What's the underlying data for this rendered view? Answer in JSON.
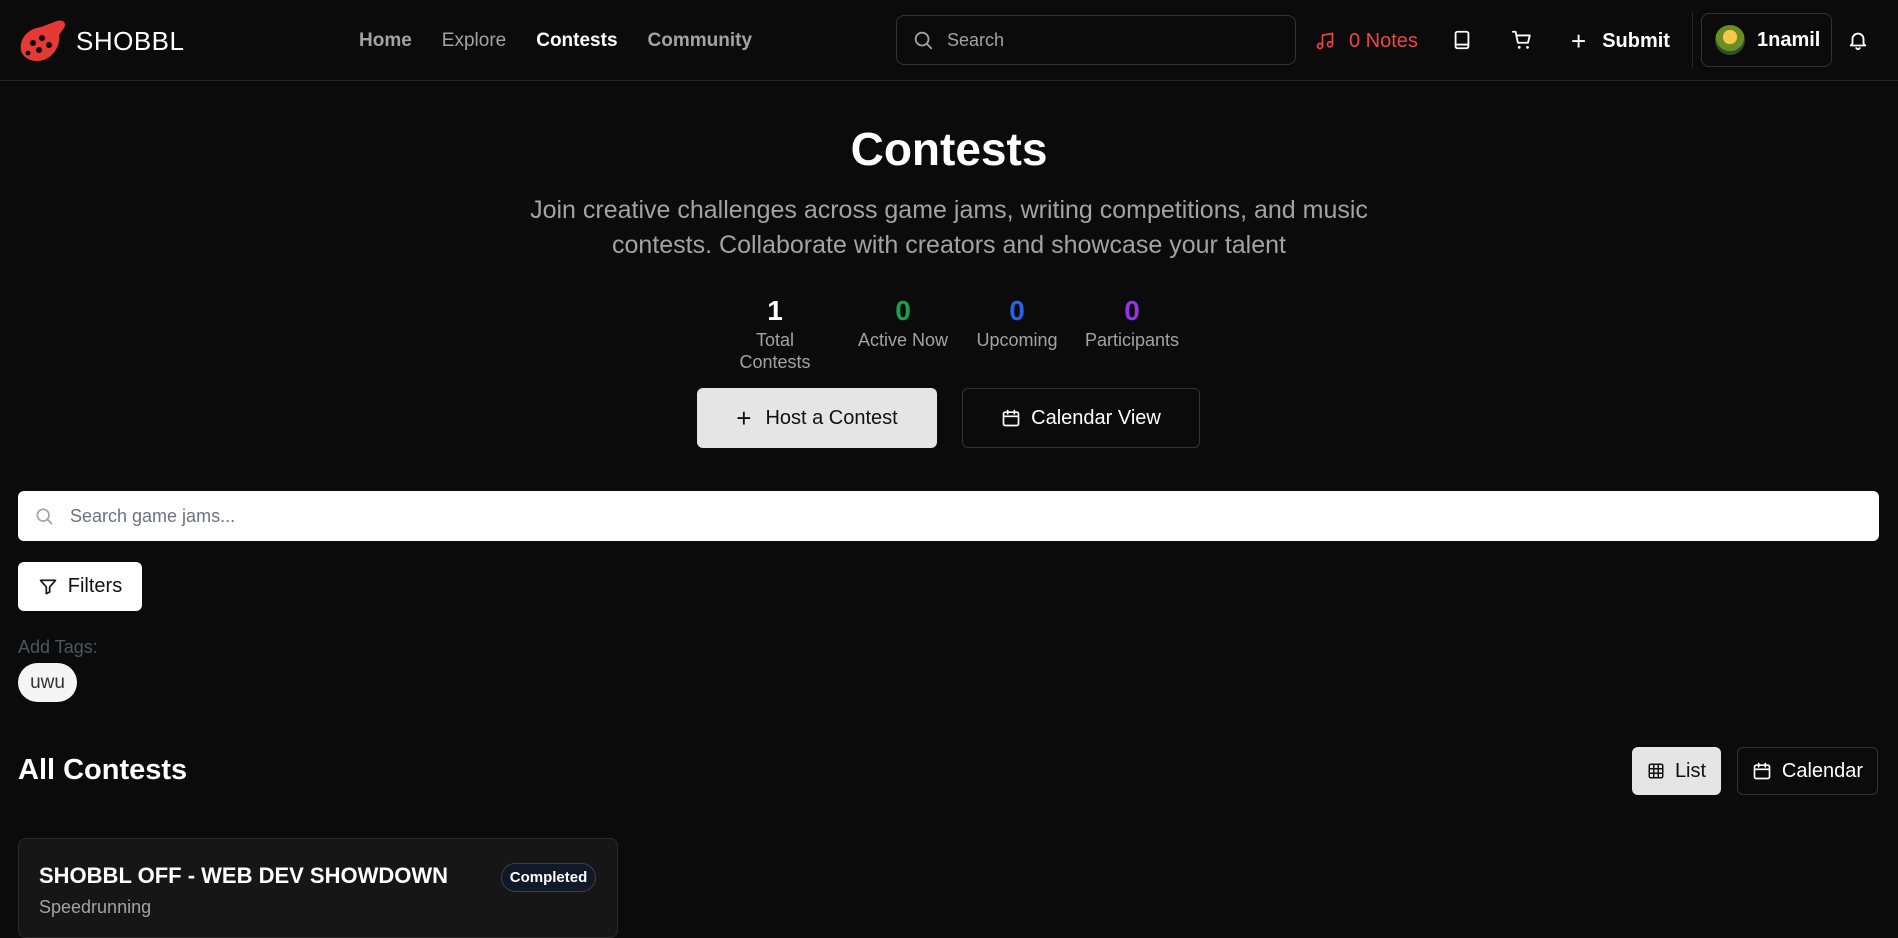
{
  "brand": {
    "name": "SHOBBL",
    "logo_icon": "ocarina-logo-icon",
    "accent": "#e53935"
  },
  "nav": {
    "items": [
      {
        "label": "Home",
        "active": false
      },
      {
        "label": "Explore",
        "active": false
      },
      {
        "label": "Contests",
        "active": true
      },
      {
        "label": "Community",
        "active": false
      }
    ]
  },
  "search": {
    "placeholder": "Search",
    "value": ""
  },
  "notes": {
    "label": "0 Notes",
    "color": "#ef4444",
    "icon": "music-note-icon"
  },
  "toolbar_icons": [
    "book-icon",
    "cart-icon",
    "bell-icon"
  ],
  "submit": {
    "label": "Submit"
  },
  "user": {
    "name": "1namil"
  },
  "hero": {
    "title": "Contests",
    "subtitle": "Join creative challenges across game jams, writing competitions, and music contests. Collaborate with creators and showcase your talent"
  },
  "stats": [
    {
      "value": "1",
      "label": "Total Contests",
      "color": "#ffffff"
    },
    {
      "value": "0",
      "label": "Active Now",
      "color": "#16a34a"
    },
    {
      "value": "0",
      "label": "Upcoming",
      "color": "#2563eb"
    },
    {
      "value": "0",
      "label": "Participants",
      "color": "#9333ea"
    }
  ],
  "actions": {
    "host": "Host a Contest",
    "calendar": "Calendar View"
  },
  "jam_search": {
    "placeholder": "Search game jams...",
    "value": ""
  },
  "filters": {
    "label": "Filters"
  },
  "tags": {
    "heading": "Add Tags:",
    "items": [
      "uwu"
    ]
  },
  "contests": {
    "heading": "All Contests",
    "view": {
      "list": "List",
      "calendar": "Calendar",
      "selected": "List"
    },
    "cards": [
      {
        "title": "SHOBBL OFF - WEB DEV SHOWDOWN",
        "category": "Speedrunning",
        "status": "Completed"
      }
    ]
  }
}
